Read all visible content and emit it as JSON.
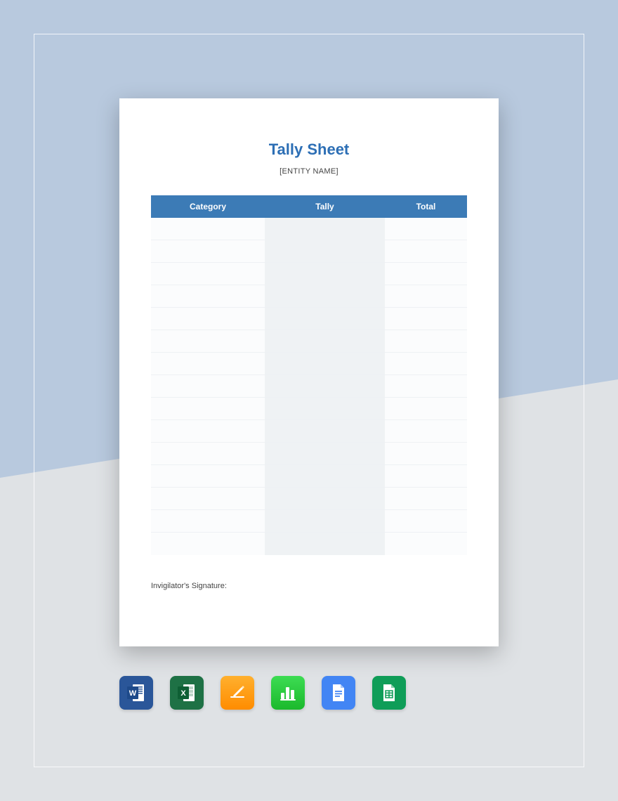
{
  "document": {
    "title": "Tally Sheet",
    "subtitle": "[ENTITY NAME]",
    "columns": {
      "category": "Category",
      "tally": "Tally",
      "total": "Total"
    },
    "rows": [
      {
        "category": "",
        "tally": "",
        "total": ""
      },
      {
        "category": "",
        "tally": "",
        "total": ""
      },
      {
        "category": "",
        "tally": "",
        "total": ""
      },
      {
        "category": "",
        "tally": "",
        "total": ""
      },
      {
        "category": "",
        "tally": "",
        "total": ""
      },
      {
        "category": "",
        "tally": "",
        "total": ""
      },
      {
        "category": "",
        "tally": "",
        "total": ""
      },
      {
        "category": "",
        "tally": "",
        "total": ""
      },
      {
        "category": "",
        "tally": "",
        "total": ""
      },
      {
        "category": "",
        "tally": "",
        "total": ""
      },
      {
        "category": "",
        "tally": "",
        "total": ""
      },
      {
        "category": "",
        "tally": "",
        "total": ""
      },
      {
        "category": "",
        "tally": "",
        "total": ""
      },
      {
        "category": "",
        "tally": "",
        "total": ""
      },
      {
        "category": "",
        "tally": "",
        "total": ""
      }
    ],
    "signature_label": "Invigilator's Signature:"
  },
  "icons": {
    "word": "word-icon",
    "excel": "excel-icon",
    "pages": "pages-icon",
    "numbers": "numbers-icon",
    "docs": "google-docs-icon",
    "sheets": "google-sheets-icon"
  },
  "colors": {
    "header_bg": "#3c7bb6",
    "title_color": "#2d6fb5",
    "bg_top": "#b8c9de",
    "bg_bottom": "#dfe2e5"
  }
}
